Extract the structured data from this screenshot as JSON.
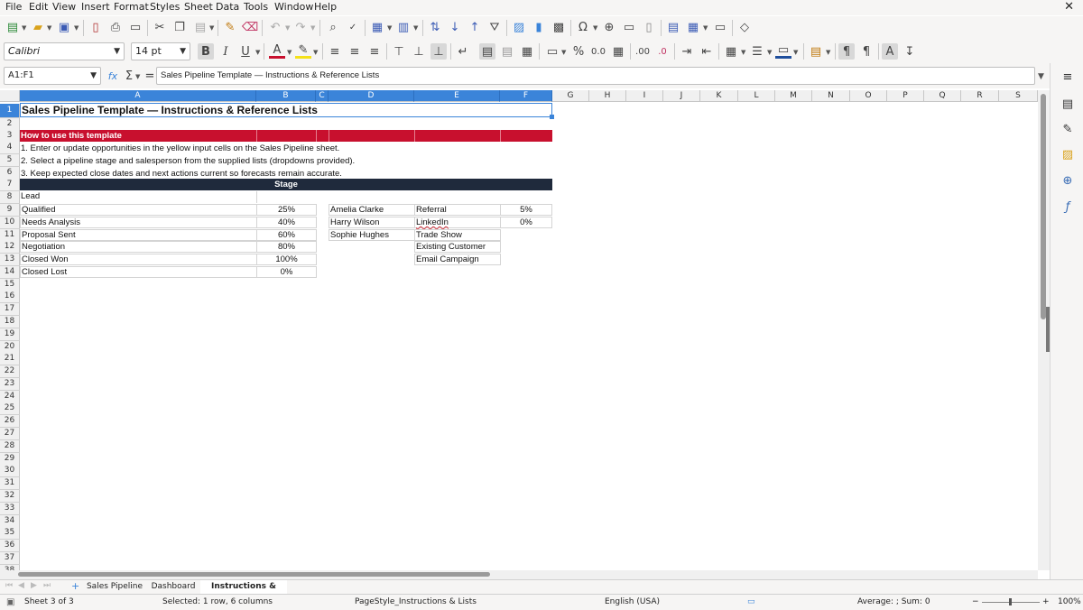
{
  "menu": [
    "File",
    "Edit",
    "View",
    "Insert",
    "Format",
    "Styles",
    "Sheet",
    "Data",
    "Tools",
    "Window",
    "Help"
  ],
  "close_glyph": "✕",
  "toolbar1_icons": [
    "new-icon",
    "open-icon",
    "save-icon",
    "export-pdf-icon",
    "print-icon",
    "print-preview-icon",
    "cut-icon",
    "copy-icon",
    "paste-icon",
    "clone-formatting-icon",
    "clear-formatting-icon",
    "undo-icon",
    "redo-icon",
    "find-replace-icon",
    "spelling-icon",
    "row-icon",
    "column-icon",
    "sort-icon",
    "sort-ascending-icon",
    "sort-descending-icon",
    "autofilter-icon",
    "image-icon",
    "chart-icon",
    "pivot-table-icon",
    "special-character-icon",
    "hyperlink-icon",
    "comment-icon",
    "header-footer-icon",
    "define-print-area-icon",
    "freeze-rows-columns-icon",
    "split-window-icon",
    "show-draw-functions-icon"
  ],
  "font": {
    "name": "Calibri",
    "size": "14 pt"
  },
  "formula": {
    "name_box": "A1:F1",
    "fx": "fx",
    "sum": "Σ",
    "equals": "=",
    "content": "Sales Pipeline Template — Instructions & Reference Lists"
  },
  "columns": [
    "A",
    "B",
    "C",
    "D",
    "E",
    "F",
    "G",
    "H",
    "I",
    "J",
    "K",
    "L",
    "M",
    "N",
    "O",
    "P",
    "Q",
    "R",
    "S"
  ],
  "rows": [
    "1",
    "2",
    "3",
    "4",
    "5",
    "6",
    "7",
    "8",
    "9",
    "10",
    "11",
    "12",
    "13",
    "14",
    "15",
    "16",
    "17",
    "18",
    "19",
    "20",
    "21",
    "22",
    "23",
    "24",
    "25",
    "26",
    "27",
    "28",
    "29",
    "30",
    "31",
    "32",
    "33",
    "34",
    "35",
    "36",
    "37",
    "38"
  ],
  "sheet": {
    "title": "Sales Pipeline Template — Instructions & Reference Lists",
    "howto_header": "How to use this template",
    "instructions": [
      "1. Enter or update opportunities in the yellow input cells on the Sales Pipeline sheet.",
      "2. Select a pipeline stage and salesperson from the supplied lists (dropdowns provided).",
      "3. Keep expected close dates and next actions current so forecasts remain accurate."
    ],
    "stage_header": "Stage",
    "stages": [
      {
        "name": "Lead",
        "prob": ""
      },
      {
        "name": "Qualified",
        "prob": "25%"
      },
      {
        "name": "Needs Analysis",
        "prob": "40%"
      },
      {
        "name": "Proposal Sent",
        "prob": "60%"
      },
      {
        "name": "Negotiation",
        "prob": "80%"
      },
      {
        "name": "Closed Won",
        "prob": "100%"
      },
      {
        "name": "Closed Lost",
        "prob": "0%"
      }
    ],
    "salespeople": [
      "Amelia Clarke",
      "Harry Wilson",
      "Sophie Hughes"
    ],
    "sources": [
      {
        "name": "Referral",
        "rate": "5%"
      },
      {
        "name": "LinkedIn",
        "rate": "0%"
      },
      {
        "name": "Trade Show",
        "rate": ""
      },
      {
        "name": "Existing Customer",
        "rate": ""
      },
      {
        "name": "Email Campaign",
        "rate": ""
      }
    ]
  },
  "tabs": [
    "Sales Pipeline",
    "Dashboard",
    "Instructions & Lists"
  ],
  "active_tab": "Instructions & Lists",
  "status": {
    "sheet": "Sheet 3 of 3",
    "selection": "Selected: 1 row, 6 columns",
    "page_style": "PageStyle_Instructions & Lists",
    "language": "English (USA)",
    "sum": "Average: ; Sum: 0",
    "zoom": "100%"
  },
  "colors": {
    "accent_red": "#c8102e",
    "navy": "#1f2a3c",
    "selection_blue": "#3b84d9"
  }
}
